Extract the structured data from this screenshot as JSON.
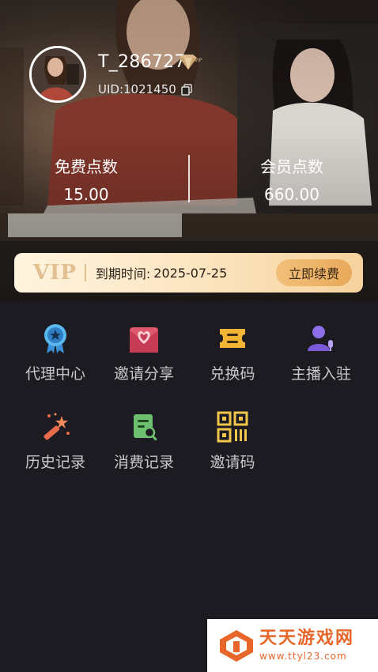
{
  "profile": {
    "username": "T_286727",
    "uid": "UID:1021450"
  },
  "stats": {
    "free_points_label": "免费点数",
    "free_points_value": "15.00",
    "member_points_label": "会员点数",
    "member_points_value": "660.00"
  },
  "vip_bar": {
    "logo": "VIP",
    "expire_label": "到期时间:",
    "expire_date": "2025-07-25",
    "renew_label": "立即续费"
  },
  "menu": [
    {
      "label": "代理中心",
      "icon": "ribbon-star-icon"
    },
    {
      "label": "邀请分享",
      "icon": "heart-envelope-icon"
    },
    {
      "label": "兑换码",
      "icon": "ticket-icon"
    },
    {
      "label": "主播入驻",
      "icon": "user-mic-icon"
    },
    {
      "label": "历史记录",
      "icon": "magic-wand-icon"
    },
    {
      "label": "消费记录",
      "icon": "receipt-search-icon"
    },
    {
      "label": "邀请码",
      "icon": "qr-code-icon"
    }
  ],
  "watermark": {
    "title": "天天游戏网",
    "url": "www.ttyl23.com"
  },
  "colors": {
    "background": "#1b1b21",
    "vip_gold": "#e8a95a",
    "watermark_orange": "#e8662a"
  }
}
